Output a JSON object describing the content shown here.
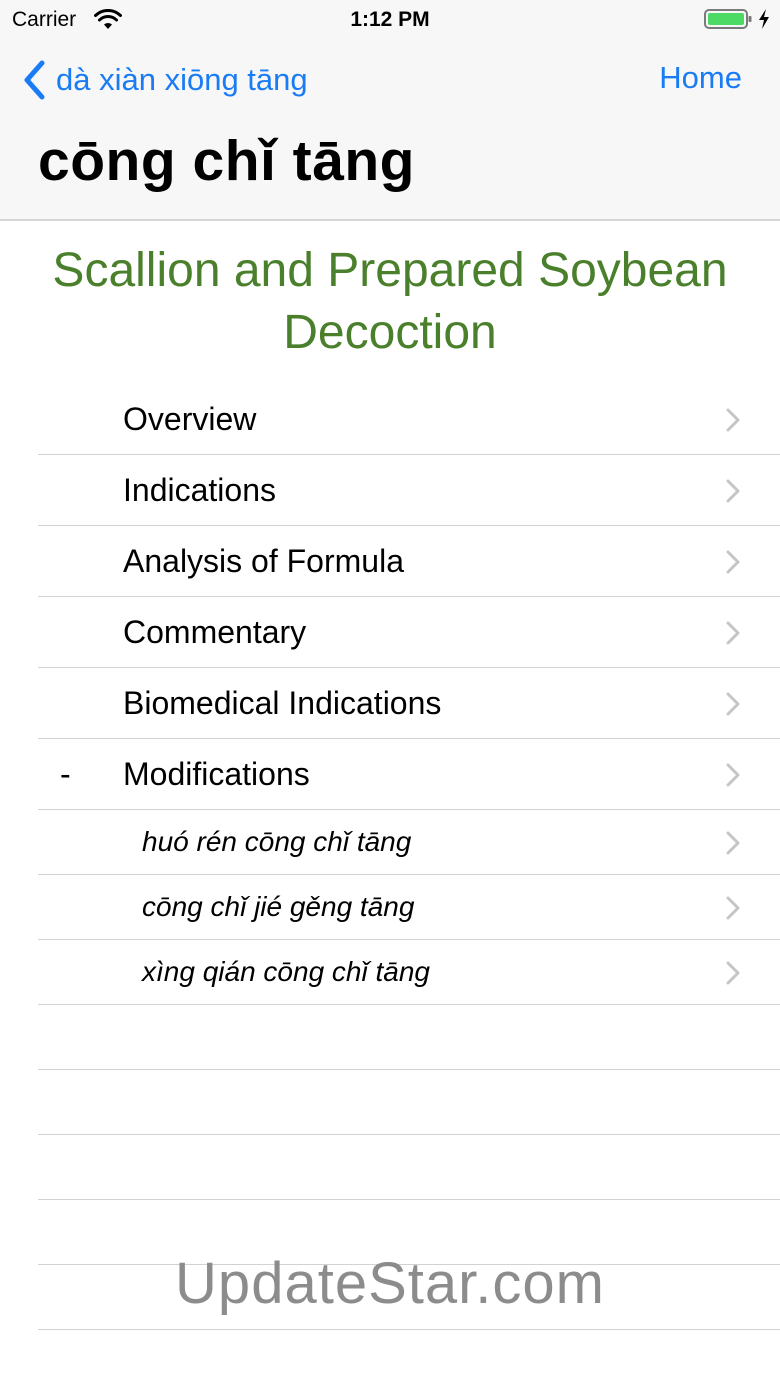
{
  "status_bar": {
    "carrier": "Carrier",
    "time": "1:12 PM"
  },
  "nav": {
    "back_label": "dà xiàn xiōng tāng",
    "home_label": "Home",
    "title": "cōng chǐ tāng"
  },
  "section_title": "Scallion and Prepared Soybean Decoction",
  "menu": {
    "overview": "Overview",
    "indications": "Indications",
    "analysis": "Analysis of Formula",
    "commentary": "Commentary",
    "biomedical": "Biomedical Indications",
    "modifications": "Modifications",
    "modifications_marker": "-",
    "sub_items": [
      "huó rén cōng chǐ tāng",
      "cōng chǐ jié gěng tāng",
      "xìng qián cōng chǐ tāng"
    ]
  },
  "watermark": "UpdateStar.com",
  "colors": {
    "accent": "#1a7cf5",
    "title_green": "#4a7f2c",
    "battery": "#4cd964"
  }
}
